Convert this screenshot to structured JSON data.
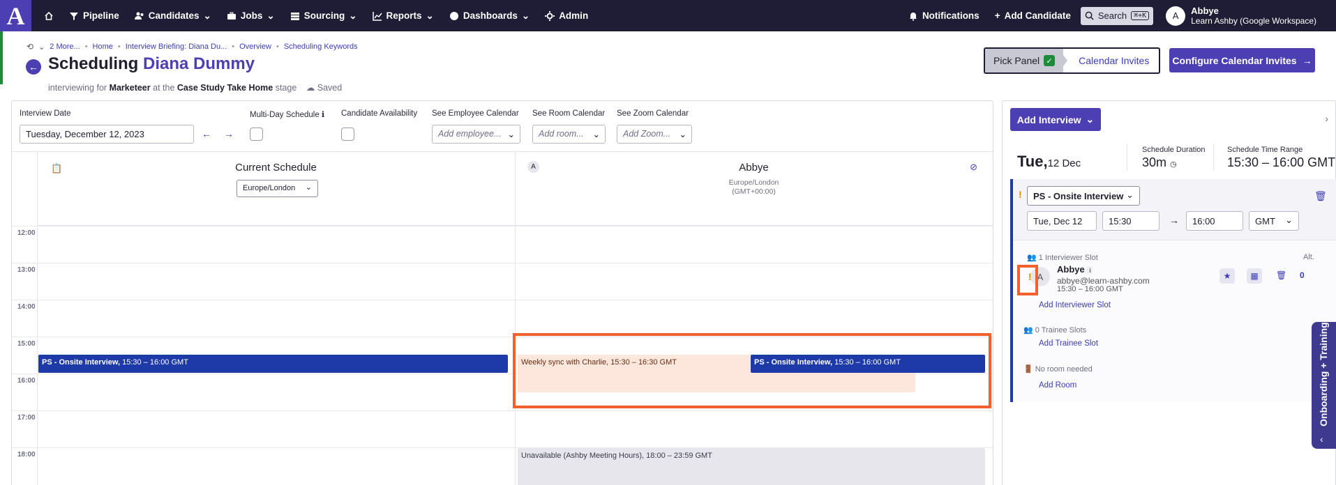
{
  "nav": {
    "logo": "A",
    "items": [
      "Pipeline",
      "Candidates",
      "Jobs",
      "Sourcing",
      "Reports",
      "Dashboards",
      "Admin"
    ],
    "notifications": "Notifications",
    "add_candidate": "Add Candidate",
    "search": "Search",
    "search_shortcut": "⌘+K",
    "user_initial": "A",
    "user_name": "Abbye",
    "user_org": "Learn Ashby (Google Workspace)"
  },
  "breadcrumbs": [
    "2 More...",
    "Home",
    "Interview Briefing: Diana Du...",
    "Overview",
    "Scheduling Keywords"
  ],
  "header": {
    "title_prefix": "Scheduling",
    "candidate_name": "Diana Dummy",
    "sub_interviewing_for": "interviewing for",
    "sub_role": "Marketeer",
    "sub_at_the": "at the",
    "sub_stage_name": "Case Study Take Home",
    "sub_stage": "stage",
    "saved": "Saved"
  },
  "steps": {
    "pick_panel": "Pick Panel",
    "calendar_invites": "Calendar Invites"
  },
  "configure_button": "Configure Calendar Invites",
  "filters": {
    "interview_date_label": "Interview Date",
    "interview_date_value": "Tuesday, December 12, 2023",
    "multi_day_label": "Multi-Day Schedule",
    "candidate_availability_label": "Candidate Availability",
    "employee_label": "See Employee Calendar",
    "employee_placeholder": "Add employee...",
    "room_label": "See Room Calendar",
    "room_placeholder": "Add room...",
    "zoom_label": "See Zoom Calendar",
    "zoom_placeholder": "Add Zoom..."
  },
  "calendar": {
    "current_schedule_title": "Current Schedule",
    "current_tz": "Europe/London",
    "person_initial": "A",
    "person_name": "Abbye",
    "person_tz": "Europe/London",
    "person_tz_offset": "(GMT+00:00)",
    "hours": [
      "12:00",
      "13:00",
      "14:00",
      "15:00",
      "16:00",
      "17:00",
      "18:00"
    ],
    "events": {
      "current_title": "PS - Onsite Interview,",
      "current_time": "15:30 – 16:00 GMT",
      "sync_title": "Weekly sync with Charlie,",
      "sync_time": "15:30 – 16:30 GMT",
      "abbye_title": "PS - Onsite Interview,",
      "abbye_time": "15:30 – 16:00 GMT",
      "unavail_title": "Unavailable (Ashby Meeting Hours),",
      "unavail_time": "18:00 – 23:59 GMT"
    }
  },
  "right": {
    "add_interview": "Add Interview",
    "day": "Tue,",
    "date": "12 Dec",
    "duration_label": "Schedule Duration",
    "duration_value": "30m",
    "range_label": "Schedule Time Range",
    "range_value": "15:30 – 16:00 GMT",
    "interview_type": "PS - Onsite Interview",
    "date_value": "Tue, Dec 12",
    "start": "15:30",
    "end": "16:00",
    "tz": "GMT",
    "interviewer_slots": "1 Interviewer Slot",
    "alt": "Alt.",
    "interviewer_initial": "A",
    "interviewer_name": "Abbye",
    "interviewer_email": "abbye@learn-ashby.com",
    "interviewer_time": "15:30 – 16:00 GMT",
    "alt_count": "0",
    "add_interviewer_slot": "Add Interviewer Slot",
    "trainee_slots": "0 Trainee Slots",
    "add_trainee_slot": "Add Trainee Slot",
    "no_room": "No room needed",
    "add_room": "Add Room"
  },
  "onboarding_tab": "Onboarding + Training"
}
